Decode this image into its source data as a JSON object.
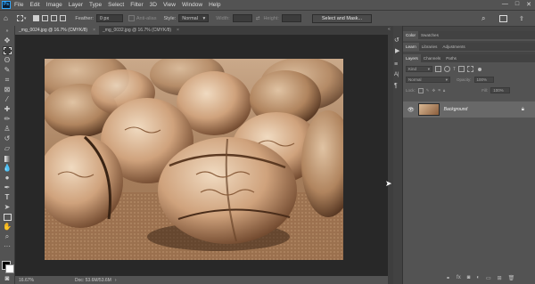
{
  "app": {
    "logo": "Ps"
  },
  "menu": [
    "File",
    "Edit",
    "Image",
    "Layer",
    "Type",
    "Select",
    "Filter",
    "3D",
    "View",
    "Window",
    "Help"
  ],
  "window_controls": {
    "minimize": "—",
    "maximize": "□",
    "close": "✕"
  },
  "options": {
    "feather_label": "Feather:",
    "feather_value": "0 px",
    "anti_alias": "Anti-alias",
    "style_label": "Style:",
    "style_value": "Normal",
    "width_label": "Width:",
    "height_label": "Height:",
    "select_mask": "Select and Mask..."
  },
  "tabs": [
    {
      "label": "_mg_0024.jpg @ 16.7% (CMYK/8)",
      "active": true
    },
    {
      "label": "_mg_0032.jpg @ 16.7% (CMYK/8)",
      "active": false
    }
  ],
  "status": {
    "zoom": "16.67%",
    "doc": "Doc: 53.6M/53.6M"
  },
  "color_panel": {
    "tabs": [
      "Color",
      "Swatches"
    ]
  },
  "learn_panel": {
    "tabs": [
      "Learn",
      "Libraries",
      "Adjustments"
    ]
  },
  "layers_panel": {
    "tabs": [
      "Layers",
      "Channels",
      "Paths"
    ],
    "kind_label": "Kind",
    "blend_mode": "Normal",
    "opacity_label": "Opacity:",
    "opacity_value": "100%",
    "lock_label": "Lock:",
    "fill_label": "Fill:",
    "fill_value": "100%",
    "layers": [
      {
        "name": "Background",
        "visible": true,
        "locked": true
      }
    ]
  },
  "colors": {
    "accent": "#31a8ff",
    "panel": "#535353",
    "canvas_bg": "#282828",
    "selected_layer": "#686868"
  }
}
